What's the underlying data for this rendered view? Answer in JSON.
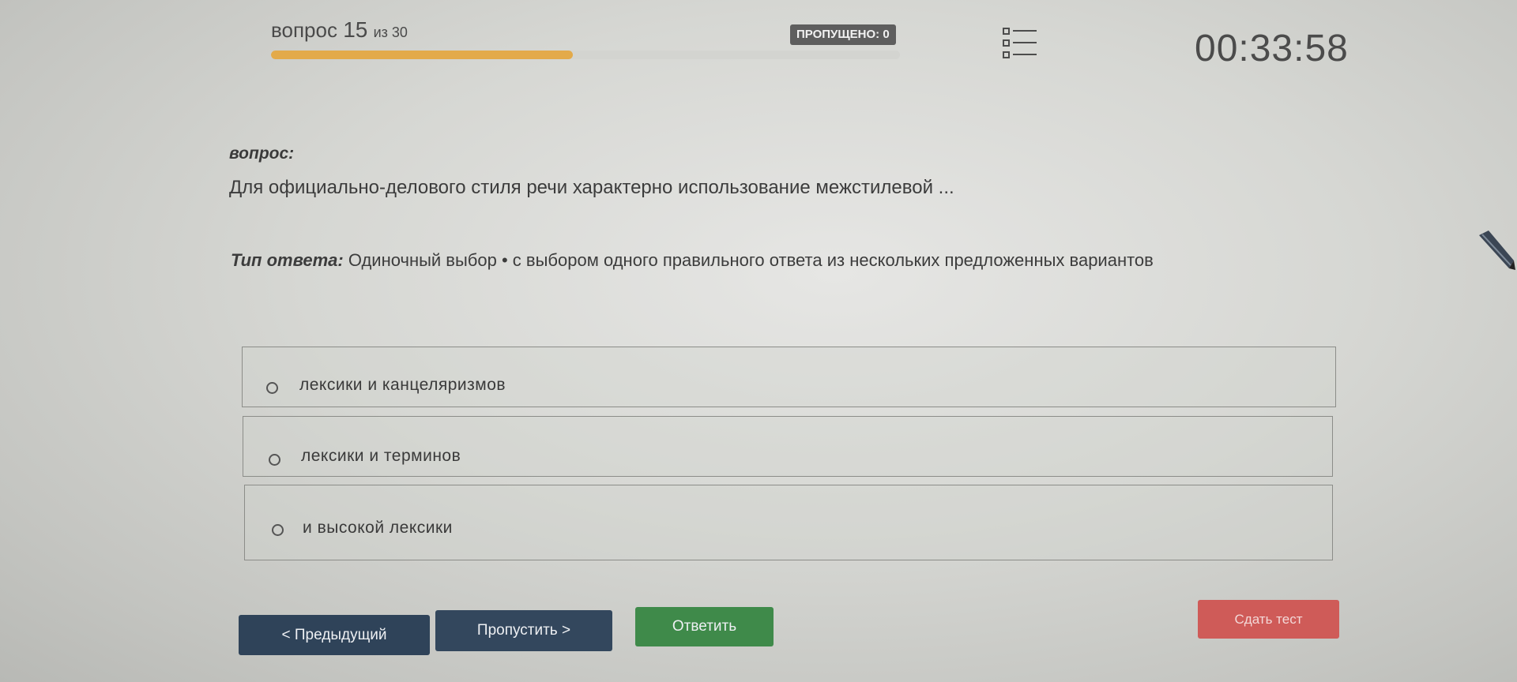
{
  "header": {
    "question_word": "вопрос",
    "question_number": "15",
    "of_total": "из 30",
    "progress": 0.48,
    "skipped_label": "ПРОПУЩЕНО: 0",
    "list_icon": "question-list-icon",
    "timer": "00:33:58"
  },
  "question": {
    "label": "вопрос:",
    "text": "Для официально-делового стиля речи характерно использование межстилевой ...",
    "type_label": "Тип ответа:",
    "type_value": "Одиночный выбор • с выбором одного правильного ответа из нескольких предложенных вариантов"
  },
  "options": [
    {
      "label": "лексики и канцеляризмов",
      "selected": false
    },
    {
      "label": "лексики и терминов",
      "selected": false
    },
    {
      "label": "и высокой лексики",
      "selected": false
    }
  ],
  "buttons": {
    "prev": "< Предыдущий",
    "skip": "Пропустить >",
    "answer": "Ответить",
    "finish": "Сдать тест"
  },
  "colors": {
    "progress": "#e3aa4a",
    "prev_button": "#2f4359",
    "skip_button": "#33475d",
    "answer_button": "#3f8a4a",
    "finish_button": "#cf5b58",
    "skipped_badge": "#5e5e5e"
  }
}
